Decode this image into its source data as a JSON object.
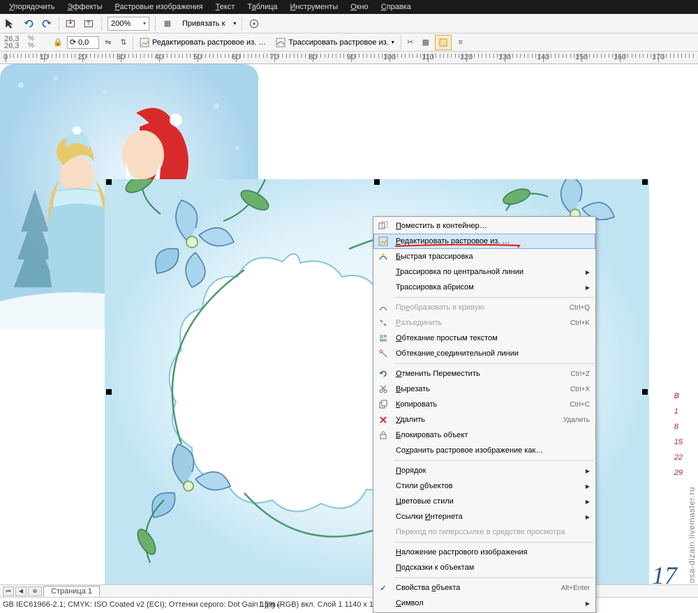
{
  "menubar": {
    "items": [
      "Упорядочить",
      "Эффекты",
      "Растровые изображения",
      "Текст",
      "Таблица",
      "Инструменты",
      "Окно",
      "Справка"
    ]
  },
  "toolbar1": {
    "zoom": "200%",
    "bind_label": "Привязать к"
  },
  "toolbar2": {
    "coord_x": "26,3",
    "coord_y": "26,3",
    "rotate": "0,0",
    "btn_edit_bitmap": "Редактировать растровое из. …",
    "btn_trace_bitmap": "Трассировать растровое из."
  },
  "ruler": {
    "marks": [
      0,
      10,
      20,
      30,
      40,
      50,
      60,
      70,
      80,
      90,
      100,
      110,
      120,
      130,
      140,
      150,
      160,
      170
    ]
  },
  "context_menu": {
    "groups": [
      [
        {
          "icon": "container",
          "label": "Поместить в контейнер…",
          "u": 0
        },
        {
          "icon": "edit-bitmap",
          "label": "Редактировать растровое из. …",
          "u": 0,
          "hover": true,
          "redline": true
        },
        {
          "icon": "quick-trace",
          "label": "Быстрая трассировка",
          "u": 0
        },
        {
          "icon": "",
          "label": "Трассировка по центральной линии",
          "u": 0,
          "submenu": true
        },
        {
          "icon": "",
          "label": "Трассировка абрисом",
          "submenu": true
        }
      ],
      [
        {
          "icon": "curve",
          "label": "Преобразовать в кривую",
          "u": 2,
          "shortcut": "Ctrl+Q",
          "disabled": true
        },
        {
          "icon": "break",
          "label": "Разъединить",
          "u": 0,
          "shortcut": "Ctrl+K",
          "disabled": true
        },
        {
          "icon": "wrap-text",
          "label": "Обтекание простым текстом",
          "u": 0
        },
        {
          "icon": "wrap-line",
          "label": "Обтекание соединительной линии",
          "u": 9
        }
      ],
      [
        {
          "icon": "undo",
          "label": "Отменить Переместить",
          "u": 0,
          "shortcut": "Ctrl+Z"
        },
        {
          "icon": "cut",
          "label": "Вырезать",
          "u": 0,
          "shortcut": "Ctrl+X"
        },
        {
          "icon": "copy",
          "label": "Копировать",
          "u": 0,
          "shortcut": "Ctrl+C"
        },
        {
          "icon": "delete",
          "label": "Удалить",
          "u": 0,
          "shortcut": "Удалить"
        },
        {
          "icon": "lock",
          "label": "Блокировать объект",
          "u": 0
        },
        {
          "icon": "",
          "label": "Сохранить растровое изображение как…",
          "u": 2
        }
      ],
      [
        {
          "icon": "",
          "label": "Порядок",
          "u": 0,
          "submenu": true
        },
        {
          "icon": "",
          "label": "Стили объектов",
          "u": 6,
          "submenu": true
        },
        {
          "icon": "",
          "label": "Цветовые стили",
          "u": 0,
          "submenu": true
        },
        {
          "icon": "",
          "label": "Ссылки Интернета",
          "u": 7,
          "submenu": true
        },
        {
          "icon": "",
          "label": "Переход по гиперссылке в средстве просмотра",
          "disabled": true
        }
      ],
      [
        {
          "icon": "",
          "label": "Наложение растрового изображения",
          "u": 0
        },
        {
          "icon": "",
          "label": "Подсказки к объектам",
          "u": 0
        }
      ],
      [
        {
          "icon": "check",
          "label": "Свойства объекта",
          "u": 9,
          "shortcut": "Alt+Enter",
          "checked": true
        },
        {
          "icon": "",
          "label": "Символ",
          "u": 0,
          "submenu": true
        }
      ]
    ]
  },
  "page_tabs": {
    "page1": "Страница 1"
  },
  "status": {
    "left": "GB IEC61966-2.1; CMYK: ISO Coated v2 (ECI); Оттенки серого: Dot Gain 15%",
    "center": "1.jpg (RGB) вкл. Слой 1 1140 x 1140 точек на дюйм"
  },
  "watermark": "osa-dizain.livemaster.ru",
  "calendar_peek": {
    "letter": "В",
    "nums": [
      "1",
      "8",
      "15",
      "22",
      "29"
    ],
    "year": "17"
  }
}
